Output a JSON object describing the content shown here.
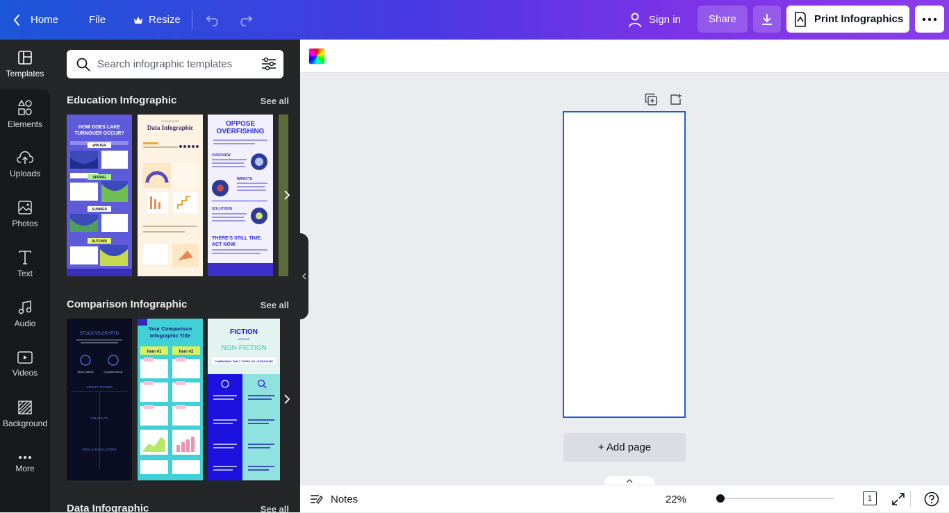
{
  "topbar": {
    "home_label": "Home",
    "file_label": "File",
    "resize_label": "Resize",
    "signin_label": "Sign in",
    "share_label": "Share",
    "print_label": "Print Infographics"
  },
  "rail": {
    "items": [
      {
        "label": "Templates",
        "icon": "templates-icon"
      },
      {
        "label": "Elements",
        "icon": "elements-icon"
      },
      {
        "label": "Uploads",
        "icon": "uploads-icon"
      },
      {
        "label": "Photos",
        "icon": "photos-icon"
      },
      {
        "label": "Text",
        "icon": "text-icon"
      },
      {
        "label": "Audio",
        "icon": "audio-icon"
      },
      {
        "label": "Videos",
        "icon": "videos-icon"
      },
      {
        "label": "Background",
        "icon": "background-icon"
      },
      {
        "label": "More",
        "icon": "more-icon"
      }
    ]
  },
  "panel": {
    "search_placeholder": "Search infographic templates",
    "sections": [
      {
        "title": "Education Infographic",
        "see_all": "See all",
        "thumbs": [
          {
            "title_lines": [
              "HOW DOES LAKE",
              "TURNOVER OCCUR?"
            ],
            "stages": [
              "WINTER",
              "SPRING",
              "SUMMER",
              "AUTUMN"
            ]
          },
          {
            "title_lines": [
              "Data Infographic"
            ],
            "sub": "CLASSROOM"
          },
          {
            "title_lines": [
              "OPPOSE",
              "OVERFISHING"
            ],
            "heads": [
              "OVERVIEW",
              "IMPACTS",
              "SOLUTIONS"
            ],
            "footer_lines": [
              "THERE'S STILL TIME.",
              "ACT NOW."
            ]
          }
        ]
      },
      {
        "title": "Comparison Infographic",
        "see_all": "See all",
        "thumbs": [
          {
            "title_lines": [
              "STOCK VS CRYPTO"
            ],
            "labels": [
              "Stock Market",
              "Cryptocurrency",
              "ASSETS TRADED",
              "VOLATILITY",
              "FEES & REGULATIONS"
            ]
          },
          {
            "title_lines": [
              "Your Comparison",
              "Infographic Title"
            ],
            "items": [
              "Item #1",
              "Item #2"
            ]
          },
          {
            "title_lines": [
              "FICTION",
              "VERSUS",
              "NON-FICTION"
            ],
            "sub": "COMPARING THE 2 TYPES OF LITERATURE"
          }
        ]
      },
      {
        "title": "Data Infographic",
        "see_all": "See all"
      }
    ]
  },
  "canvas": {
    "add_page_label": "+ Add page"
  },
  "bottombar": {
    "notes_label": "Notes",
    "zoom": "22%",
    "page_count": "1"
  },
  "colors": {
    "accent": "#1b5cd6",
    "rail_bg": "#18191b",
    "panel_bg": "#252627"
  }
}
